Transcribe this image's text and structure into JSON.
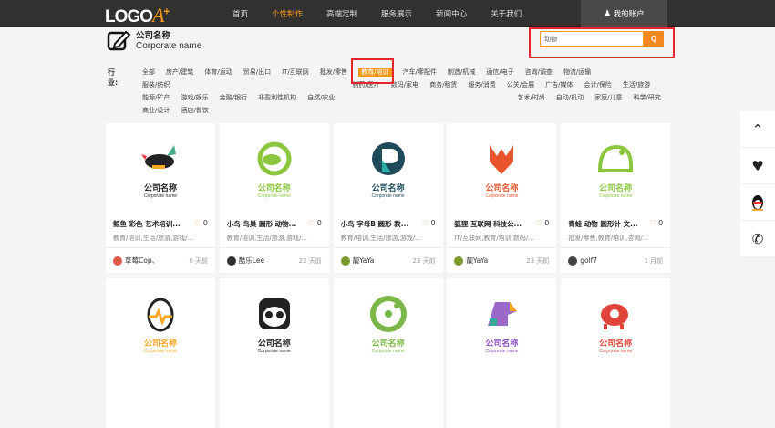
{
  "header": {
    "logo": "LOGO",
    "logo_mark": "A",
    "logo_plus": "+",
    "nav": [
      "首页",
      "个性制作",
      "高端定制",
      "服务展示",
      "新闻中心",
      "关于我们"
    ],
    "active_nav": 1,
    "account": "我的账户"
  },
  "brand": {
    "title": "公司名称",
    "subtitle": "Corporate name"
  },
  "search": {
    "value": "动物"
  },
  "industry": {
    "label": "行业:",
    "selected": 6,
    "tags": [
      "全部",
      "房产/建筑",
      "体育/运动",
      "贸易/出口",
      "IT/互联网",
      "批发/零售",
      "教育/培训",
      "汽车/零配件",
      "制造/机械",
      "通信/电子",
      "咨询/调查",
      "物流/运输",
      "服装/纺织",
      "制药/医疗",
      "数码/家电",
      "商务/租赁",
      "服务/消费",
      "公关/会展",
      "广告/媒体",
      "会计/保险",
      "生活/旅游",
      "能源/矿产",
      "游戏/娱乐",
      "金融/银行",
      "非盈利性机构",
      "自然/农业",
      "艺术/时尚",
      "自动/机动",
      "家庭/儿童",
      "科学/研究",
      "商业/设计",
      "酒店/餐饮"
    ]
  },
  "cards": [
    {
      "cn": "公司名称",
      "en": "Corporate name",
      "color": "#222222",
      "title": "鲸鱼 彩色 艺术培训...",
      "likes": "0",
      "tags": "教育/培训,生活/旅游,游戏/...",
      "user": "草莓Cop、",
      "time": "6 天前",
      "avatar": "#e05a4a"
    },
    {
      "cn": "公司名称",
      "en": "Corporate name",
      "color": "#8cc63f",
      "title": "小鸟 鸟巢 圆形 动物...",
      "likes": "0",
      "tags": "教育/培训,生活/旅游,游戏/...",
      "user": "酷乐Lee",
      "time": "22 天前",
      "avatar": "#333333"
    },
    {
      "cn": "公司名称",
      "en": "Corporate name",
      "color": "#1e4a5a",
      "title": "小鸟 字母B 圆形 教...",
      "likes": "0",
      "tags": "教育/培训,生活/旅游,游戏/...",
      "user": "靓YaYa",
      "time": "23 天前",
      "avatar": "#7a9a2a"
    },
    {
      "cn": "公司名称",
      "en": "Corporate name",
      "color": "#e8542c",
      "title": "狐狸 互联网 科技公...",
      "likes": "0",
      "tags": "IT/互联网,教育/培训,数码/...",
      "user": "靓YaYa",
      "time": "23 天前",
      "avatar": "#7a9a2a"
    },
    {
      "cn": "公司名称",
      "en": "Corporate name",
      "color": "#8cc63f",
      "title": "青蛙 动物 圆形针 文...",
      "likes": "0",
      "tags": "批发/零售,教育/培训,咨询/...",
      "user": "golf7",
      "time": "1 月前",
      "avatar": "#444444"
    },
    {
      "cn": "公司名称",
      "en": "Corporate name",
      "color": "#f5a623"
    },
    {
      "cn": "公司名称",
      "en": "Corporate name",
      "color": "#222222"
    },
    {
      "cn": "公司名称",
      "en": "Corporate name",
      "color": "#7ab648"
    },
    {
      "cn": "公司名称",
      "en": "Corporate name",
      "color": "#8a4fbf"
    },
    {
      "cn": "公司名称",
      "en": "Corporate name",
      "color": "#e0443a"
    }
  ],
  "sidebar": [
    "back-to-top",
    "favorite",
    "qq",
    "phone"
  ]
}
